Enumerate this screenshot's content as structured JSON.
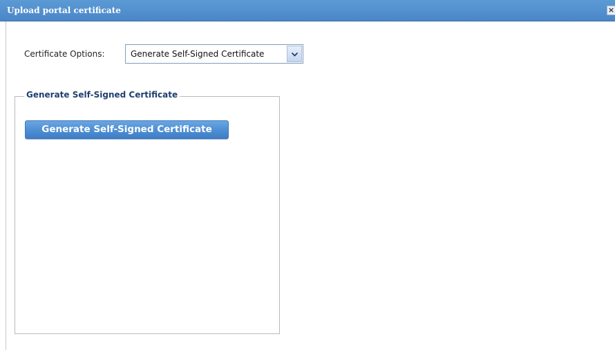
{
  "dialog": {
    "title": "Upload portal certificate",
    "close_icon": "close-icon",
    "close_glyph": "×"
  },
  "certificate_options": {
    "label": "Certificate Options:",
    "selected": "Generate Self-Signed Certificate",
    "arrow_icon": "chevron-down-icon"
  },
  "section": {
    "legend": "Generate Self-Signed Certificate",
    "button_label": "Generate Self-Signed Certificate"
  },
  "colors": {
    "title_bar": "#4a86c8",
    "button": "#4f8fd4",
    "legend_text": "#1f3f6f"
  }
}
